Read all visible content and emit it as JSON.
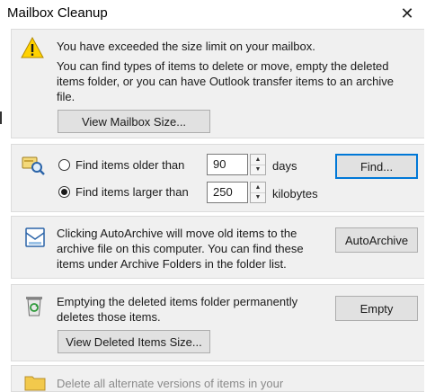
{
  "window": {
    "title": "Mailbox Cleanup",
    "close_glyph": "✕"
  },
  "size_warning": {
    "heading": "You have exceeded the size limit on your mailbox.",
    "body_line1": "You can find types of items to delete or move, empty the deleted",
    "body_line2": "items folder, or you can have Outlook transfer items to an archive",
    "body_line3": "file.",
    "view_size_button": "View Mailbox Size...",
    "icon": "warning-icon"
  },
  "find": {
    "icon": "find-items-icon",
    "older": {
      "label": "Find items older than",
      "value": "90",
      "unit": "days",
      "selected": false
    },
    "larger": {
      "label": "Find items larger than",
      "value": "250",
      "unit": "kilobytes",
      "selected": true
    },
    "find_button": "Find..."
  },
  "autoarchive": {
    "icon": "autoarchive-icon",
    "line1": "Clicking AutoArchive will move old items to the",
    "line2": "archive file on this computer. You can find these",
    "line3": "items under Archive Folders in the folder list.",
    "button": "AutoArchive"
  },
  "deleted": {
    "icon": "recycle-bin-icon",
    "line1": "Emptying the deleted items folder permanently",
    "line2": "deletes those items.",
    "empty_button": "Empty",
    "view_button": "View Deleted Items Size..."
  },
  "conflicts": {
    "icon": "folder-icon",
    "partial_text": "Delete all alternate versions of items in your"
  },
  "colors": {
    "accent": "#0078d7",
    "warning": "#ffd200",
    "panel": "#f0f0f0"
  }
}
